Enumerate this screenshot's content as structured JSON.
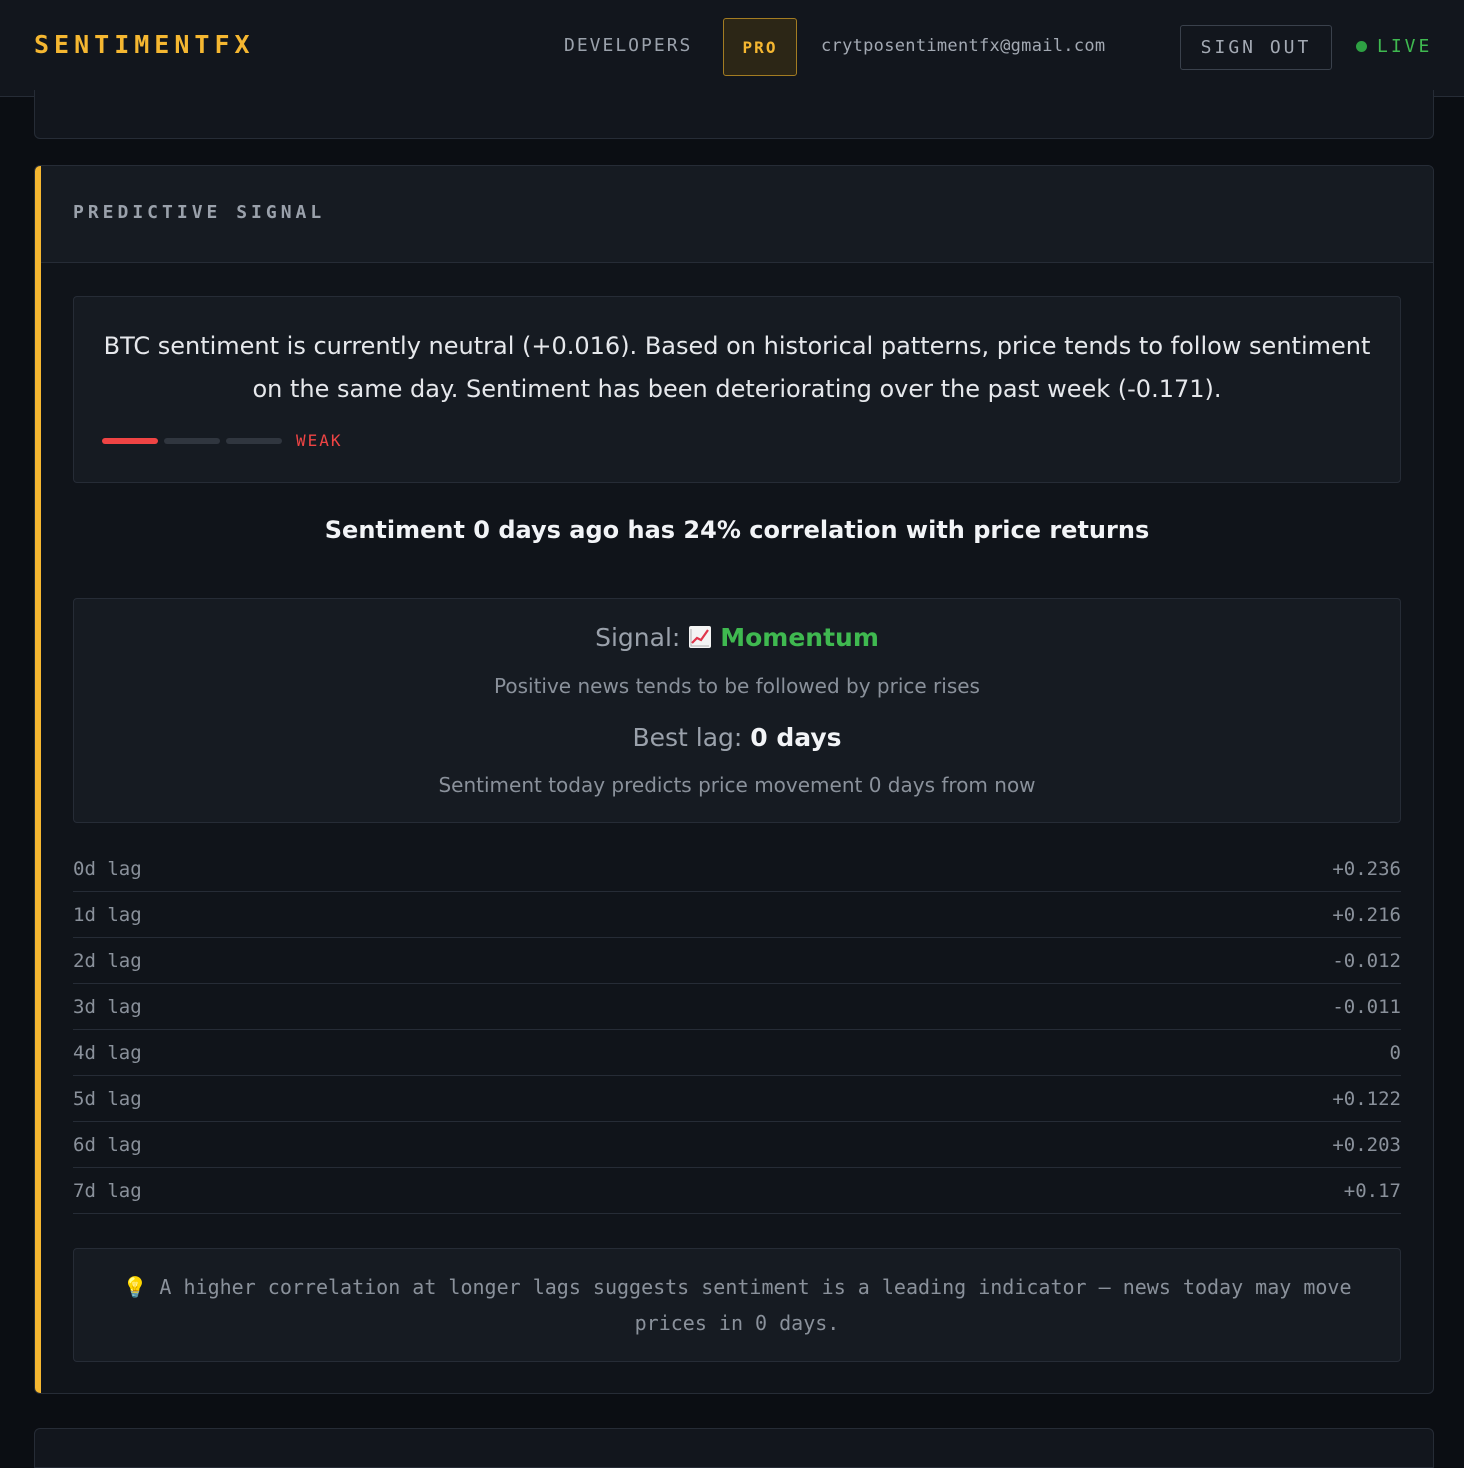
{
  "header": {
    "brand": "SENTIMENTFX",
    "developers_label": "DEVELOPERS",
    "pro_label": "PRO",
    "email": "crytposentimentfx@gmail.com",
    "signout_label": "SIGN OUT",
    "live_label": "LIVE",
    "live_color": "#3fb950"
  },
  "card": {
    "title": "PREDICTIVE SIGNAL",
    "accent_color": "#f5b731",
    "summary": "BTC sentiment is currently neutral (+0.016). Based on historical patterns, price tends to follow sentiment on the same day. Sentiment has been deteriorating over the past week (-0.171).",
    "strength": {
      "label": "WEAK",
      "level": 1,
      "max": 3,
      "color": "#ef4444"
    },
    "headline": "Sentiment 0 days ago has 24% correlation with price returns",
    "signal": {
      "label": "Signal:",
      "icon": "chart-increasing-icon",
      "value": "Momentum",
      "description": "Positive news tends to be followed by price rises"
    },
    "best_lag": {
      "label": "Best lag:",
      "value": "0 days",
      "description": "Sentiment today predicts price movement 0 days from now"
    },
    "lags": [
      {
        "label": "0d lag",
        "value": "+0.236"
      },
      {
        "label": "1d lag",
        "value": "+0.216"
      },
      {
        "label": "2d lag",
        "value": "-0.012"
      },
      {
        "label": "3d lag",
        "value": "-0.011"
      },
      {
        "label": "4d lag",
        "value": "0"
      },
      {
        "label": "5d lag",
        "value": "+0.122"
      },
      {
        "label": "6d lag",
        "value": "+0.203"
      },
      {
        "label": "7d lag",
        "value": "+0.17"
      }
    ],
    "tip": {
      "icon": "lightbulb-icon",
      "text": "A higher correlation at longer lags suggests sentiment is a leading indicator — news today may move prices in 0 days."
    }
  }
}
